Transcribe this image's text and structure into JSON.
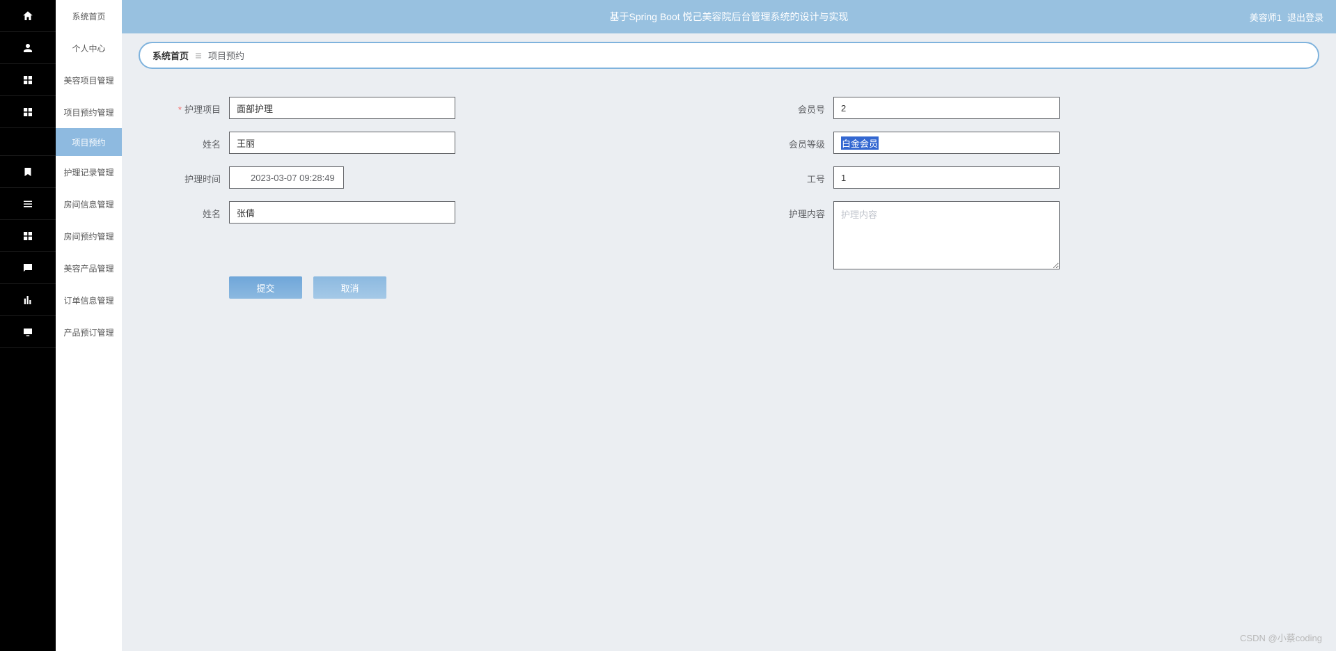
{
  "header": {
    "title": "基于Spring Boot 悦己美容院后台管理系统的设计与实现",
    "user": "美容师1",
    "logout": "退出登录"
  },
  "sidebar": {
    "items": [
      {
        "label": "系统首页",
        "icon": "home"
      },
      {
        "label": "个人中心",
        "icon": "user"
      },
      {
        "label": "美容项目管理",
        "icon": "grid"
      },
      {
        "label": "项目预约管理",
        "icon": "grid"
      },
      {
        "label": "项目预约",
        "active": true
      },
      {
        "label": "护理记录管理",
        "icon": "bookmark"
      },
      {
        "label": "房间信息管理",
        "icon": "list"
      },
      {
        "label": "房间预约管理",
        "icon": "grid"
      },
      {
        "label": "美容产品管理",
        "icon": "chat"
      },
      {
        "label": "订单信息管理",
        "icon": "chart"
      },
      {
        "label": "产品预订管理",
        "icon": "screen"
      }
    ]
  },
  "breadcrumb": {
    "home": "系统首页",
    "current": "项目预约"
  },
  "form": {
    "left": {
      "care_project": {
        "label": "护理项目",
        "value": "面部护理",
        "required": true
      },
      "name1": {
        "label": "姓名",
        "value": "王丽"
      },
      "care_time": {
        "label": "护理时间",
        "value": "2023-03-07 09:28:49"
      },
      "name2": {
        "label": "姓名",
        "value": "张倩"
      }
    },
    "right": {
      "member_no": {
        "label": "会员号",
        "value": "2"
      },
      "member_level": {
        "label": "会员等级",
        "value": "白金会员"
      },
      "job_no": {
        "label": "工号",
        "value": "1"
      },
      "care_content": {
        "label": "护理内容",
        "placeholder": "护理内容",
        "value": ""
      }
    }
  },
  "buttons": {
    "submit": "提交",
    "cancel": "取消"
  },
  "watermark": "CSDN @小蔡coding"
}
